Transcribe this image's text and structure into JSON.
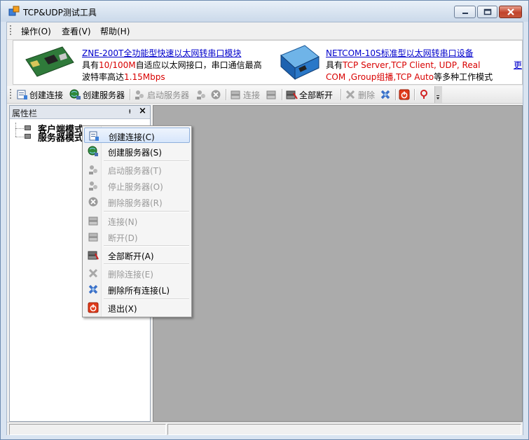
{
  "window": {
    "title": "TCP&UDP测试工具"
  },
  "menu": [
    {
      "label": "操作(O)"
    },
    {
      "label": "查看(V)"
    },
    {
      "label": "帮助(H)"
    }
  ],
  "ads": {
    "ad1": {
      "link": "ZNE-200T全功能型快速以太网转串口模块",
      "l1_a": "具有",
      "l1_b": "10/100M",
      "l1_c": "自适应以太网接口，串口通信最高",
      "l2_a": "波特率高达",
      "l2_b": "1.15Mbps"
    },
    "ad2": {
      "link": "NETCOM-10S标准型以太网转串口设备",
      "l1_a": "具有",
      "l1_b": "TCP Server,TCP Client, UDP, Real",
      "l2_a": "COM ,Group组播,TCP Auto",
      "l2_b": "等多种工作模式"
    },
    "more": "更多"
  },
  "toolbar": {
    "create_conn": "创建连接",
    "create_server": "创建服务器",
    "start_server": "启动服务器",
    "connect": "连接",
    "disconnect_all": "全部断开",
    "delete": "删除"
  },
  "panel": {
    "title": "属性栏",
    "pin": "ᵽ",
    "close": "×",
    "tree": [
      "客户端模式",
      "服务器模式"
    ]
  },
  "context_menu": [
    {
      "label": "创建连接(C)",
      "enabled": true,
      "highlight": true
    },
    {
      "label": "创建服务器(S)",
      "enabled": true
    },
    {
      "label": "启动服务器(T)",
      "enabled": false
    },
    {
      "label": "停止服务器(O)",
      "enabled": false
    },
    {
      "label": "删除服务器(R)",
      "enabled": false
    },
    {
      "label": "连接(N)",
      "enabled": false
    },
    {
      "label": "断开(D)",
      "enabled": false
    },
    {
      "label": "全部断开(A)",
      "enabled": true
    },
    {
      "label": "删除连接(E)",
      "enabled": false
    },
    {
      "label": "删除所有连接(L)",
      "enabled": true
    },
    {
      "label": "退出(X)",
      "enabled": true
    }
  ]
}
